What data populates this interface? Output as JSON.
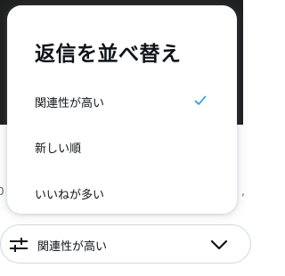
{
  "popup": {
    "title": "返信を並べ替え",
    "options": [
      {
        "label": "関連性が高い",
        "selected": true
      },
      {
        "label": "新しい順",
        "selected": false
      },
      {
        "label": "いいねが多い",
        "selected": false
      }
    ]
  },
  "sort_bar": {
    "label": "関連性が高い"
  },
  "colors": {
    "accent": "#1d9bf0",
    "text": "#0f1419",
    "border": "#cfd9de",
    "backdrop": "#1f1f1f"
  },
  "icons": [
    "check-icon",
    "sliders-icon",
    "chevron-down-icon"
  ]
}
